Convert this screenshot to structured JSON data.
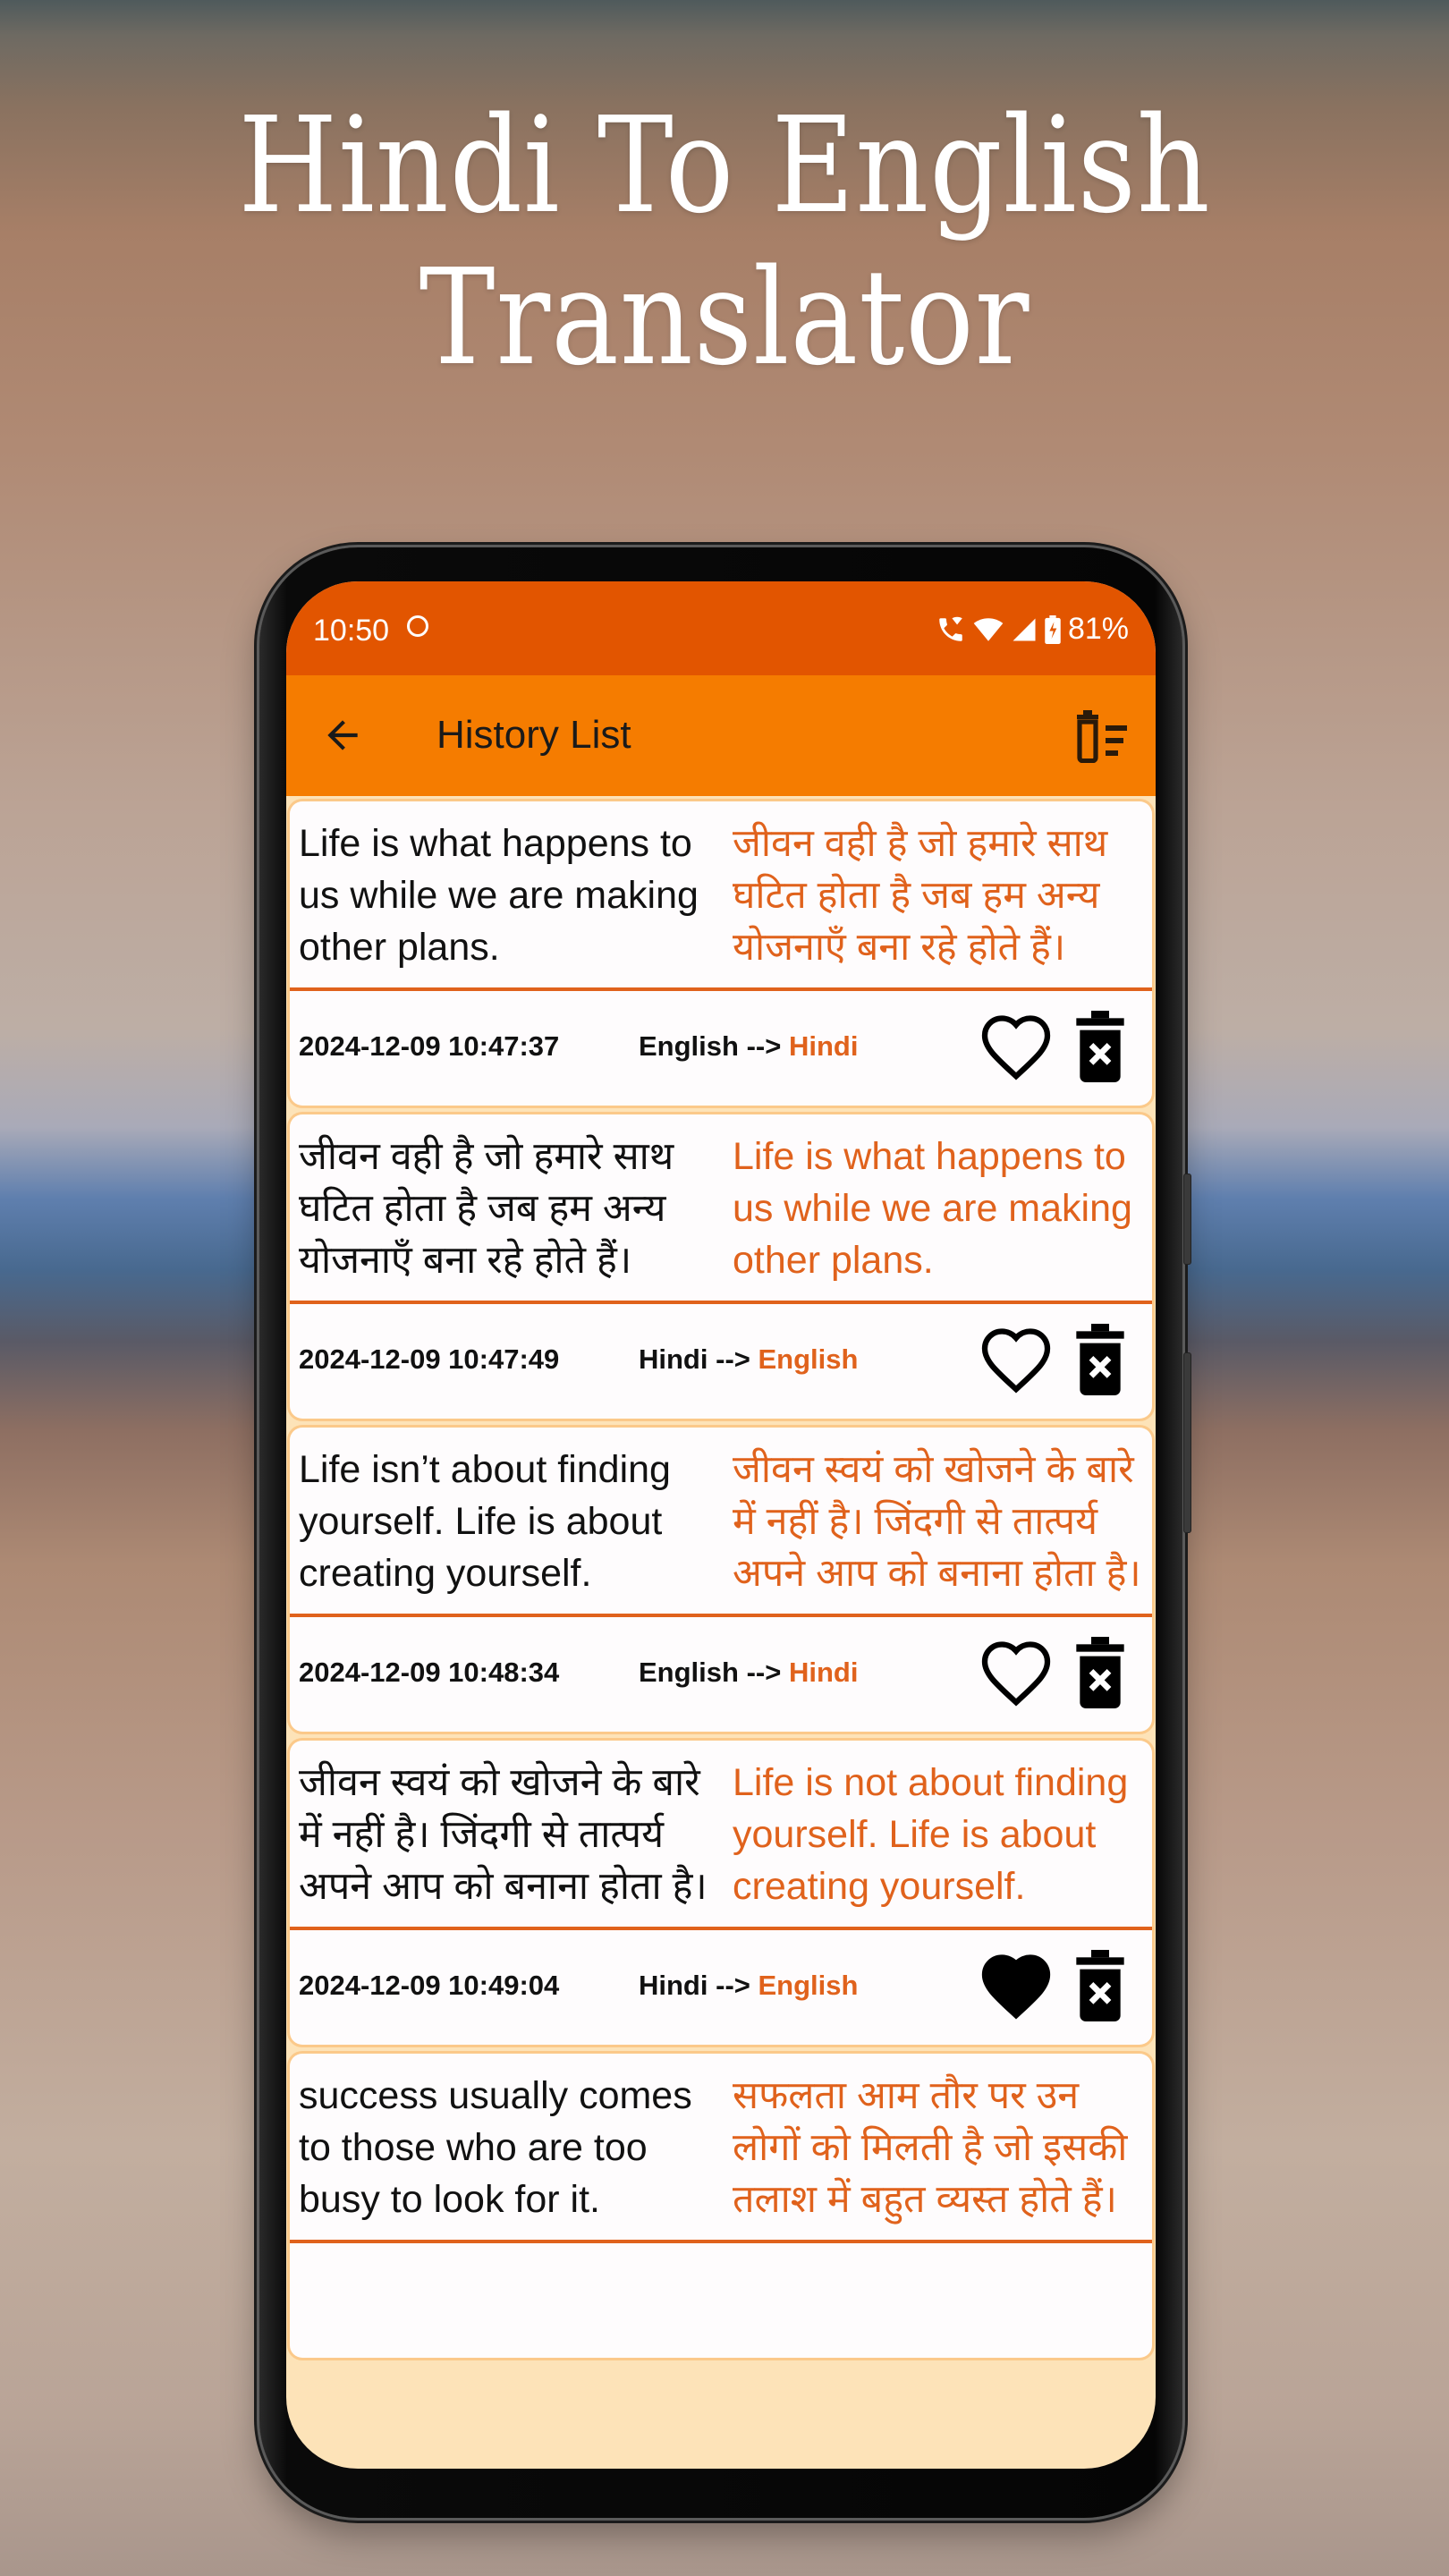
{
  "hero": {
    "line1": "Hindi To English",
    "line2": "Translator"
  },
  "status_bar": {
    "time": "10:50",
    "battery": "81%",
    "icons": [
      "notification-circle-icon",
      "wifi-call-icon",
      "wifi-icon",
      "signal-icon",
      "battery-charging-icon"
    ]
  },
  "app_bar": {
    "title": "History List",
    "back_icon": "arrow-left-icon",
    "clear_icon": "delete-sweep-icon"
  },
  "history": [
    {
      "source": "Life is what happens to us while we are making other plans.",
      "translation": "जीवन वही है जो हमारे साथ घटित होता है जब हम अन्य योजनाएँ बना रहे होते हैं।",
      "timestamp": "2024-12-09 10:47:37",
      "from": "English",
      "arrow": "-->",
      "to": "Hindi",
      "favorite": false
    },
    {
      "source": "जीवन वही है जो हमारे साथ घटित होता है जब हम अन्य योजनाएँ बना रहे होते हैं।",
      "translation": "Life is what happens to us while we are making other plans.",
      "timestamp": "2024-12-09 10:47:49",
      "from": "Hindi",
      "arrow": "-->",
      "to": "English",
      "favorite": false
    },
    {
      "source": "Life isn’t about finding yourself. Life is about creating yourself.",
      "translation": "जीवन स्वयं को खोजने के बारे में नहीं है। जिंदगी से तात्पर्य अपने आप को बनाना होता है।",
      "timestamp": "2024-12-09 10:48:34",
      "from": "English",
      "arrow": "-->",
      "to": "Hindi",
      "favorite": false
    },
    {
      "source": "जीवन स्वयं को खोजने के बारे में नहीं है। जिंदगी से तात्पर्य अपने आप को बनाना होता है।",
      "translation": "Life is not about finding yourself. Life is about creating yourself.",
      "timestamp": "2024-12-09 10:49:04",
      "from": "Hindi",
      "arrow": "-->",
      "to": "English",
      "favorite": true
    },
    {
      "source": "success usually comes to those who are too busy to look for it.",
      "translation": "सफलता आम तौर पर उन लोगों को मिलती है जो इसकी तलाश में बहुत व्यस्त होते हैं।",
      "timestamp": "",
      "from": "",
      "arrow": "",
      "to": "",
      "favorite": false
    }
  ],
  "colors": {
    "status_bar": "#e25500",
    "app_bar": "#f57c00",
    "accent_text": "#e0621c",
    "card_border": "#fbc98a"
  }
}
